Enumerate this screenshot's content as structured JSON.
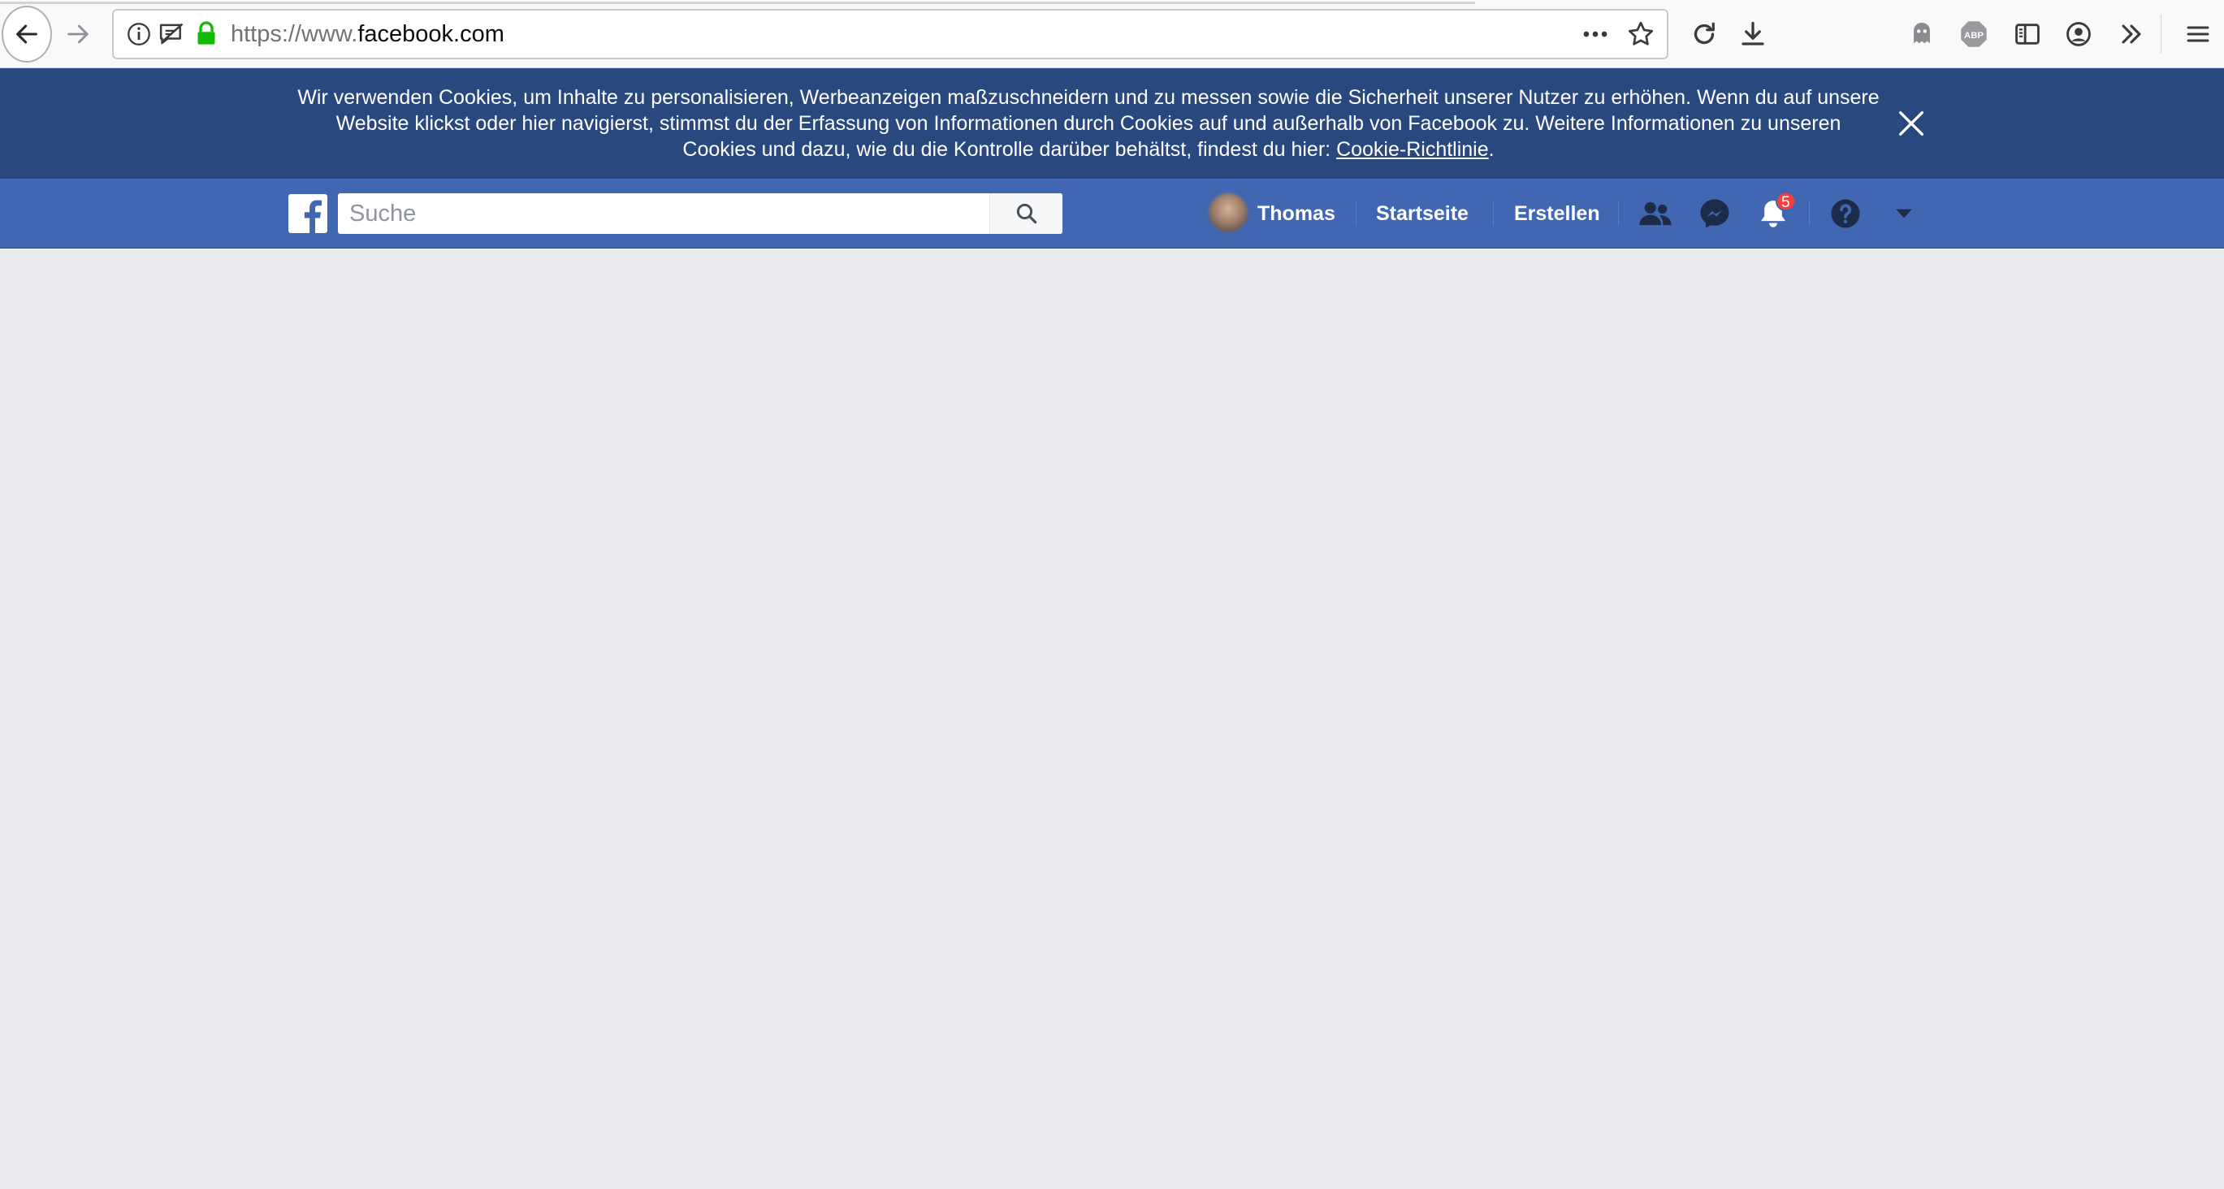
{
  "browser": {
    "url_scheme": "https://www.",
    "url_host": "facebook.com",
    "icons": [
      "back-icon",
      "forward-icon",
      "info-icon",
      "permissions-icon",
      "lock-icon",
      "more-icon",
      "bookmark-star-icon",
      "reload-icon",
      "download-icon",
      "ghostery-icon",
      "adblock-icon",
      "sidebar-icon",
      "account-icon",
      "overflow-icon",
      "menu-icon"
    ],
    "lock_color": "#12bc00"
  },
  "cookie_banner": {
    "line1": "Wir verwenden Cookies, um Inhalte zu personalisieren, Werbeanzeigen maßzuschneidern und zu messen sowie die Sicherheit unserer Nutzer zu erhöhen. Wenn du auf unsere",
    "line2": "Website klickst oder hier navigierst, stimmst du der Erfassung von Informationen durch Cookies auf und außerhalb von Facebook zu. Weitere Informationen zu unseren",
    "line3": "Cookies und dazu, wie du die Kontrolle darüber behältst, findest du hier: ",
    "link": "Cookie-Richtlinie",
    "period": ".",
    "background": "#29487d"
  },
  "fb_header": {
    "search_placeholder": "Suche",
    "user_name": "Thomas",
    "nav_home": "Startseite",
    "nav_create": "Erstellen",
    "notification_count": "5",
    "bar_color": "#4267b2",
    "badge_color": "#fa3e3e"
  }
}
